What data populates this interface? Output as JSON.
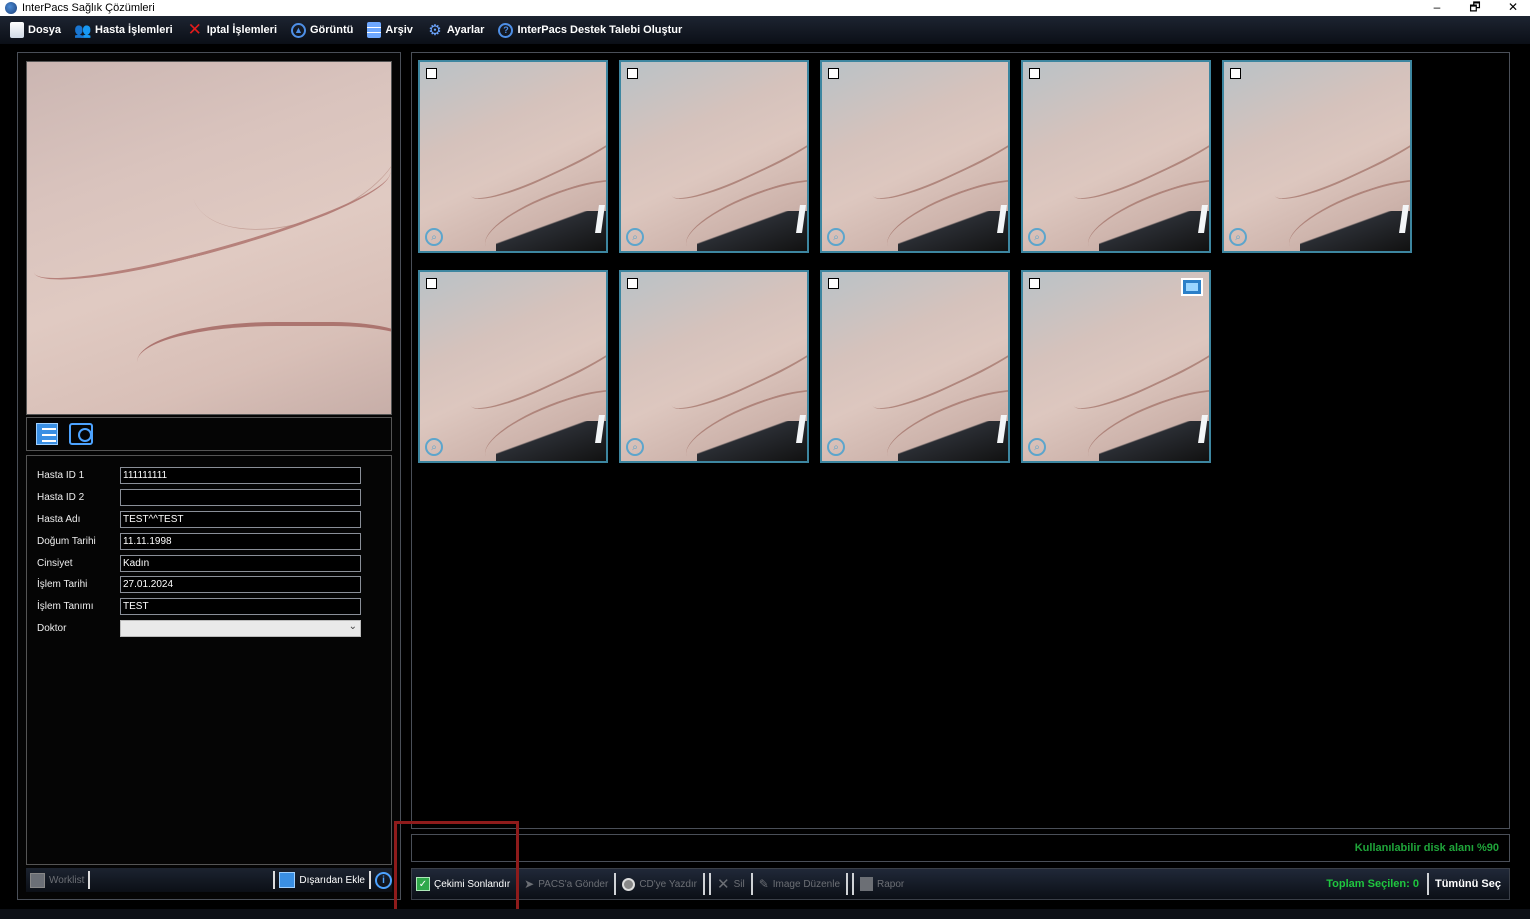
{
  "window": {
    "title": "InterPacs Sağlık Çözümleri",
    "controls": {
      "minimize": "–",
      "restore": "🗗",
      "close": "✕"
    }
  },
  "menu": {
    "items": [
      {
        "label": "Dosya",
        "icon": "file-icon"
      },
      {
        "label": "Hasta İşlemleri",
        "icon": "users-icon"
      },
      {
        "label": "Iptal İşlemleri",
        "icon": "cancel-icon"
      },
      {
        "label": "Görüntü",
        "icon": "image-icon"
      },
      {
        "label": "Arşiv",
        "icon": "archive-icon"
      },
      {
        "label": "Ayarlar",
        "icon": "gear-icon"
      },
      {
        "label": "InterPacs Destek Talebi Oluştur",
        "icon": "help-icon"
      }
    ]
  },
  "patient": {
    "fields": [
      {
        "label": "Hasta ID 1",
        "value": "111111111"
      },
      {
        "label": "Hasta ID 2",
        "value": ""
      },
      {
        "label": "Hasta Adı",
        "value": "TEST^^TEST"
      },
      {
        "label": "Doğum Tarihi",
        "value": "11.11.1998"
      },
      {
        "label": "Cinsiyet",
        "value": "Kadın"
      },
      {
        "label": "İşlem Tarihi",
        "value": "27.01.2024"
      },
      {
        "label": "İşlem Tanımı",
        "value": "TEST"
      }
    ],
    "doctor_label": "Doktor",
    "doctor_value": ""
  },
  "left_footer": {
    "worklist": "Worklist",
    "import": "Dışarıdan Ekle",
    "info_icon": "i"
  },
  "gallery": {
    "thumbnails": [
      {
        "type": "image",
        "checked": false
      },
      {
        "type": "image",
        "checked": false
      },
      {
        "type": "image",
        "checked": false
      },
      {
        "type": "image",
        "checked": false
      },
      {
        "type": "image",
        "checked": false
      },
      {
        "type": "image",
        "checked": false
      },
      {
        "type": "image",
        "checked": false
      },
      {
        "type": "image",
        "checked": false
      },
      {
        "type": "video",
        "checked": false
      }
    ]
  },
  "status": {
    "disk_space": "Kullanılabilir disk alanı %90"
  },
  "toolbar": {
    "finish": "Çekimi Sonlandır",
    "send_pacs": "PACS'a Gönder",
    "burn_cd": "CD'ye Yazdır",
    "delete": "Sil",
    "edit_image": "Image Düzenle",
    "report": "Rapor",
    "total_selected": "Toplam Seçilen: 0",
    "select_all": "Tümünü Seç"
  },
  "colors": {
    "accent": "#4da3ff",
    "thumb_border": "#3d86a0",
    "disk_text": "#1fa53a",
    "selected_text": "#1fc63f",
    "highlight": "#8e1b1b"
  }
}
